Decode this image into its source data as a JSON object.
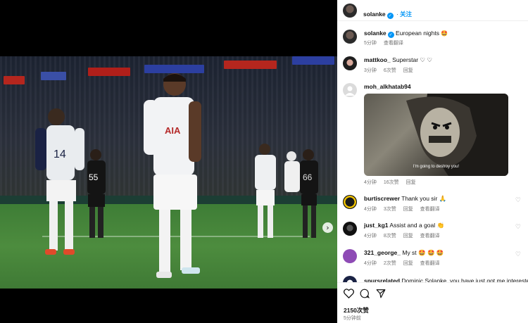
{
  "photo": {
    "next_icon": "chevron-right-icon",
    "jersey_sponsor": "AIA",
    "jersey_numbers": [
      "14",
      "55",
      "66"
    ]
  },
  "header": {
    "username": "solanke",
    "follow_label": "关注"
  },
  "caption": {
    "username": "solanke",
    "text": "European nights",
    "emoji": "🤩",
    "time": "5分钟",
    "translate": "查看翻译"
  },
  "comments": [
    {
      "username": "mattkoo_",
      "text": "Superstar ♡ ♡",
      "time": "3分钟",
      "likes": "6次赞",
      "reply": "回复"
    },
    {
      "username": "moh_alkhatab94",
      "text": "",
      "gif_caption": "I'm going to destroy you!",
      "time": "4分钟",
      "likes": "16次赞",
      "reply": "回复"
    },
    {
      "username": "burtiscrewer",
      "text": "Thank you sir 🙏",
      "time": "4分钟",
      "likes": "3次赞",
      "reply": "回复",
      "translate": "查看翻译"
    },
    {
      "username": "just_kg1",
      "text": "Assist and a goal 👏",
      "time": "4分钟",
      "likes": "8次赞",
      "reply": "回复",
      "translate": "查看翻译"
    },
    {
      "username": "321_george_",
      "text": "My st 🤩 🤩 🤩",
      "time": "4分钟",
      "likes": "2次赞",
      "reply": "回复",
      "translate": "查看翻译"
    },
    {
      "username": "spursrelated",
      "text": "Dominic Solanke, you have just got me interested"
    }
  ],
  "actions": {
    "like_icon": "heart-icon",
    "comment_icon": "comment-icon",
    "share_icon": "share-icon",
    "likes": "2150次赞",
    "time": "5分钟前"
  },
  "colors": {
    "link_blue": "#0095f6",
    "meta_gray": "#737373",
    "pitch_green": "#4d8c3e"
  }
}
